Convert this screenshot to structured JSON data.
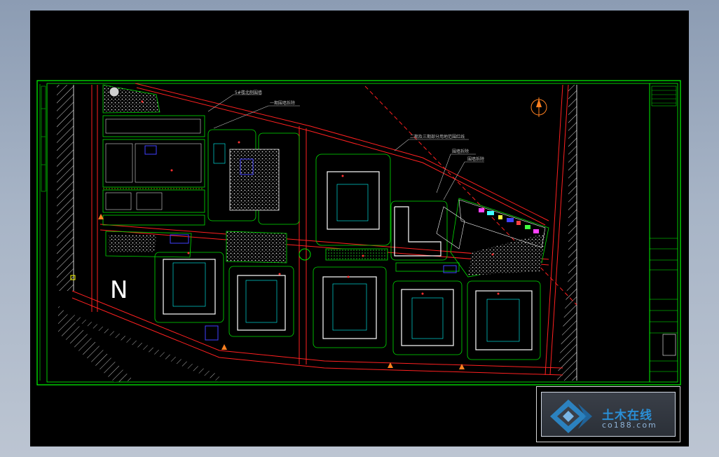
{
  "drawing": {
    "north_letter": "N",
    "annotations": [
      {
        "id": "a1",
        "text": "5#楼北侧围墙"
      },
      {
        "id": "a2",
        "text": "一期围墙拆除"
      },
      {
        "id": "a3",
        "text": "二期及三期部分用地范围红线"
      },
      {
        "id": "a4",
        "text": "围墙拆除"
      },
      {
        "id": "a5",
        "text": "围墙拆除"
      }
    ],
    "colors": {
      "background": "#000000",
      "frame": "#00ff00",
      "road_line": "#ff2020",
      "block_outline": "#00e000",
      "building": "#ffffff",
      "hatch": "#c8c8c8",
      "accent_cyan": "#00ffff",
      "accent_blue": "#4040ff",
      "annotation_text": "#c0c0c0"
    }
  },
  "watermark": {
    "logo_text": "土木在线",
    "url_text": "co188.com"
  }
}
